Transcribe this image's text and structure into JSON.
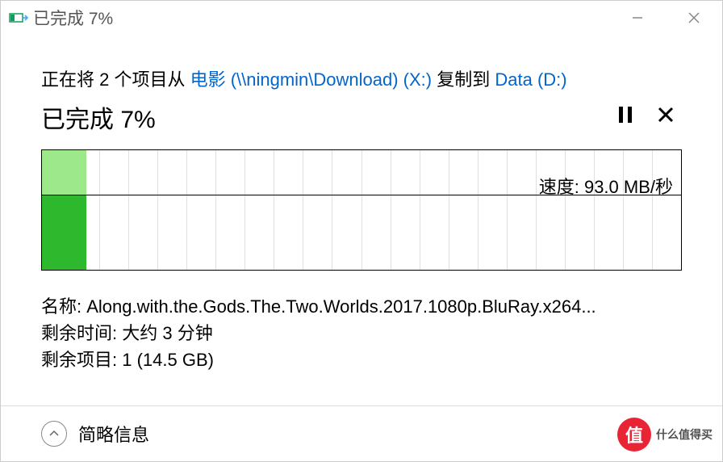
{
  "window": {
    "title": "已完成 7%"
  },
  "copy": {
    "prefix": "正在将 2 个项目从 ",
    "source": "电影 (\\\\ningmin\\Download) (X:)",
    "middle": " 复制到 ",
    "dest": "Data (D:)"
  },
  "status": "已完成 7%",
  "speed": {
    "label": "速度: ",
    "value": "93.0 MB/秒"
  },
  "details": {
    "name_label": "名称: ",
    "name_value": "Along.with.the.Gods.The.Two.Worlds.2017.1080p.BluRay.x264...",
    "time_label": "剩余时间: ",
    "time_value": "大约 3 分钟",
    "items_label": "剩余项目: ",
    "items_value": "1 (14.5 GB)"
  },
  "footer": {
    "toggle": "简略信息"
  },
  "watermark": {
    "badge": "值",
    "text": "什么值得买"
  },
  "chart_data": {
    "type": "area",
    "title": "Copy speed over time",
    "progress_percent": 7,
    "current_speed_mb_s": 93.0,
    "ylim": [
      0,
      170
    ],
    "ylabel": "MB/秒"
  }
}
